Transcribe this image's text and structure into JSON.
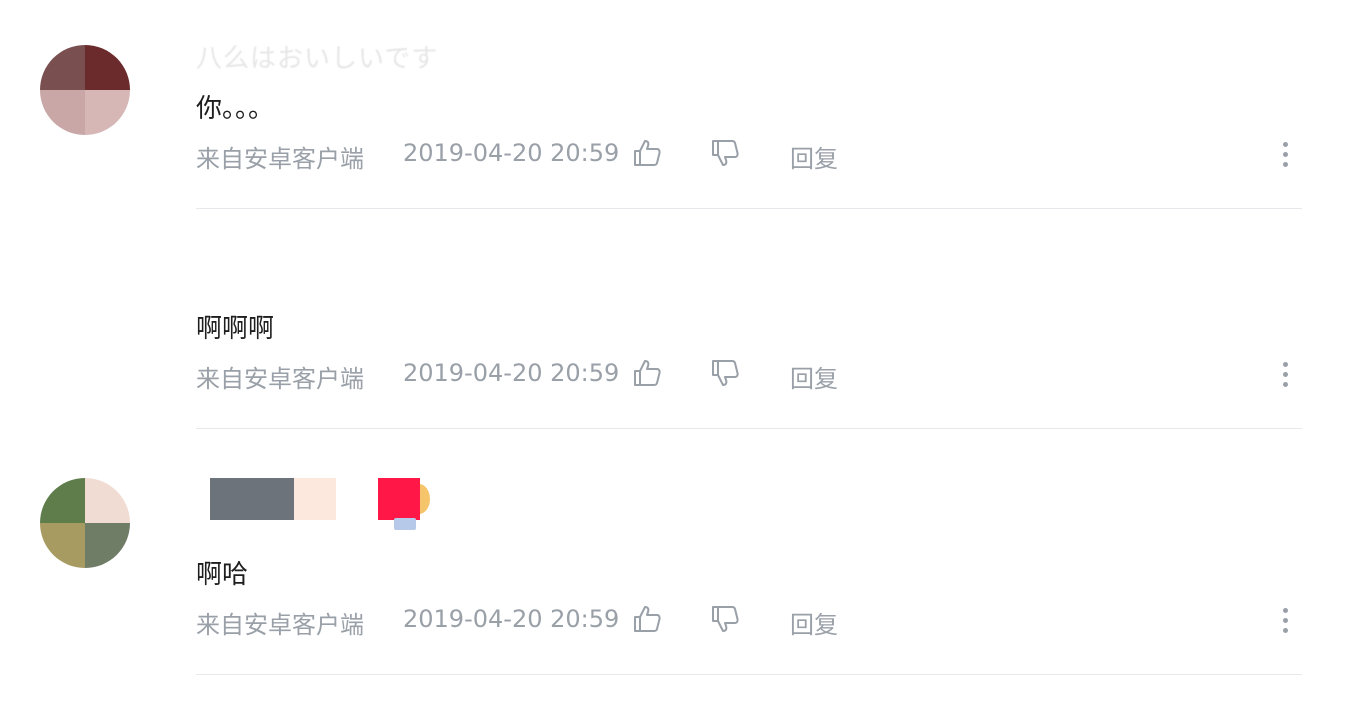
{
  "comments": [
    {
      "partial_header": "八么はおいしいです",
      "text": "你。。。",
      "source": "来自安卓客户端",
      "time": "2019-04-20 20:59",
      "reply_label": "回复"
    },
    {
      "text": "啊啊啊",
      "source": "来自安卓客户端",
      "time": "2019-04-20 20:59",
      "reply_label": "回复"
    },
    {
      "text": "啊哈",
      "source": "来自安卓客户端",
      "time": "2019-04-20 20:59",
      "reply_label": "回复"
    }
  ],
  "icons": {
    "like": "thumbs-up-icon",
    "dislike": "thumbs-down-icon",
    "more": "more-vertical-icon"
  },
  "colors": {
    "meta_text": "#9aa0a8",
    "divider": "#e6e8eb",
    "content_text": "#1e1e1e"
  }
}
